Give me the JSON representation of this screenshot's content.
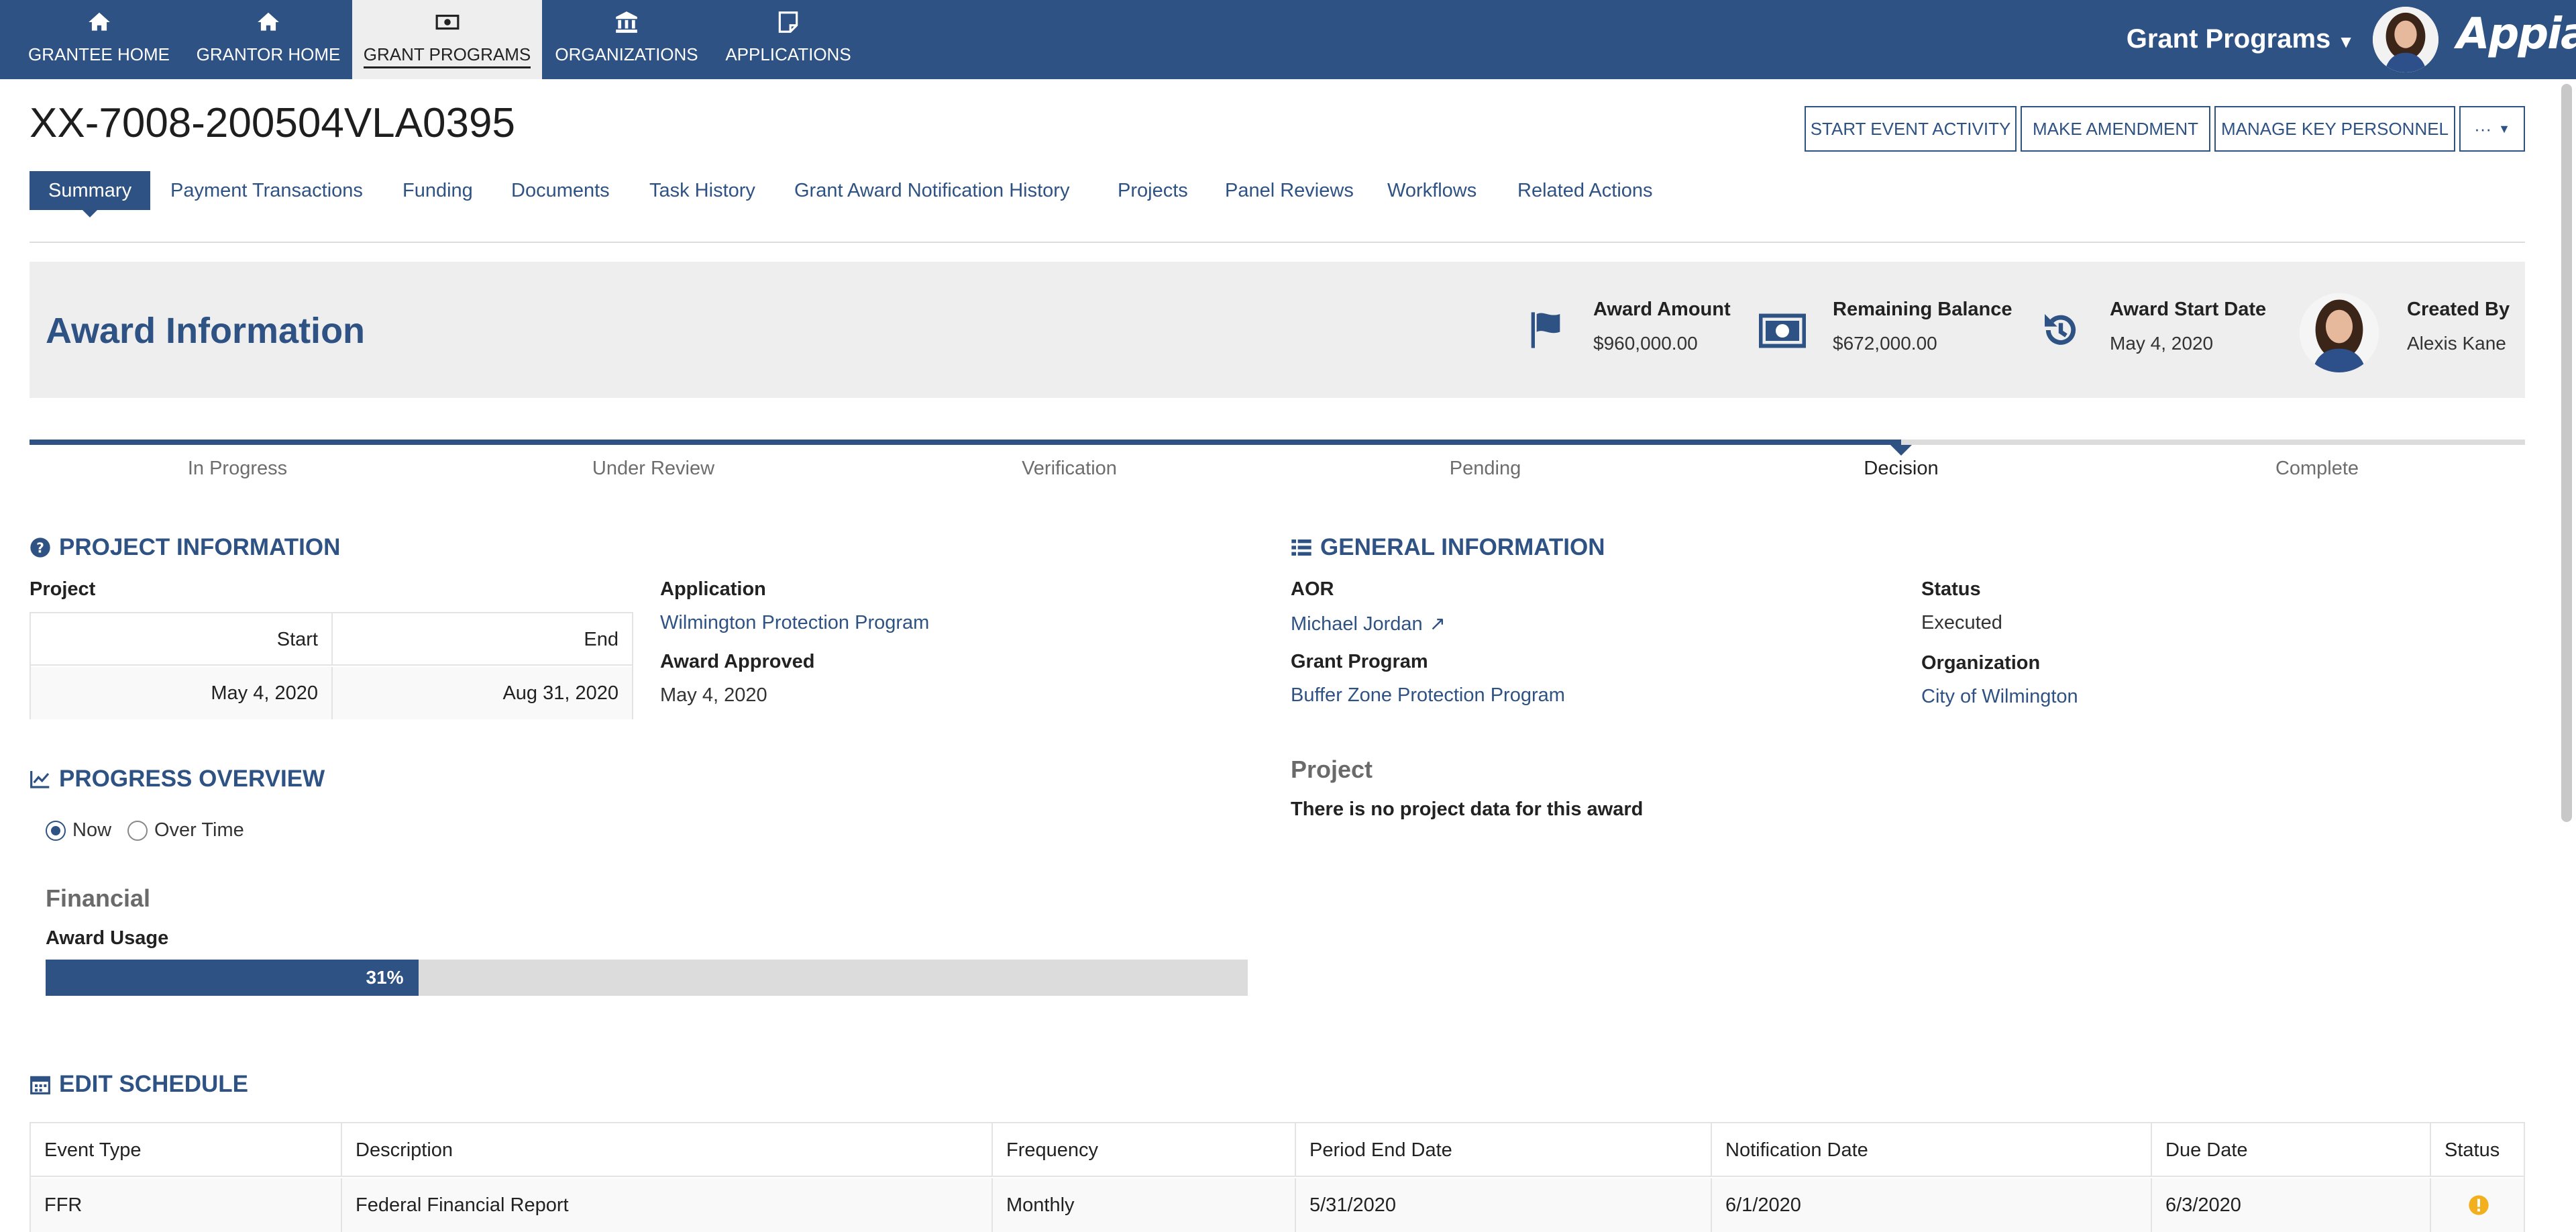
{
  "nav": {
    "tabs": [
      {
        "label": "GRANTEE HOME",
        "icon": "home-icon"
      },
      {
        "label": "GRANTOR HOME",
        "icon": "home-icon"
      },
      {
        "label": "GRANT PROGRAMS",
        "icon": "money-icon"
      },
      {
        "label": "ORGANIZATIONS",
        "icon": "institution-icon"
      },
      {
        "label": "APPLICATIONS",
        "icon": "note-icon"
      }
    ],
    "active_tab": "GRANT PROGRAMS",
    "site_title": "Grant Programs",
    "logo": "Appian"
  },
  "record": {
    "title": "XX-7008-200504VLA0395",
    "actions": [
      "START EVENT ACTIVITY",
      "MAKE AMENDMENT",
      "MANAGE KEY PERSONNEL",
      "···"
    ],
    "tabs": [
      "Summary",
      "Payment Transactions",
      "Funding",
      "Documents",
      "Task History",
      "Grant Award Notification History",
      "Projects",
      "Panel Reviews",
      "Workflows",
      "Related Actions"
    ],
    "active_tab": "Summary"
  },
  "award": {
    "title": "Award Information",
    "kpis": [
      {
        "label": "Award Amount",
        "value": "$960,000.00",
        "icon": "flag-icon"
      },
      {
        "label": "Remaining Balance",
        "value": "$672,000.00",
        "icon": "money-icon"
      },
      {
        "label": "Award Start Date",
        "value": "May 4, 2020",
        "icon": "history-icon"
      },
      {
        "label": "Created By",
        "value": "Alexis Kane",
        "icon": "avatar"
      }
    ]
  },
  "milestone": {
    "steps": [
      "In Progress",
      "Under Review",
      "Verification",
      "Pending",
      "Decision",
      "Complete"
    ],
    "current_index": 4
  },
  "project_info": {
    "heading": "PROJECT INFORMATION",
    "project_label": "Project",
    "start_header": "Start",
    "end_header": "End",
    "start_value": "May 4, 2020",
    "end_value": "Aug 31, 2020",
    "application_label": "Application",
    "application_value": "Wilmington Protection Program",
    "award_approved_label": "Award Approved",
    "award_approved_value": "May 4, 2020"
  },
  "general_info": {
    "heading": "GENERAL INFORMATION",
    "aor_label": "AOR",
    "aor_value": "Michael Jordan",
    "status_label": "Status",
    "status_value": "Executed",
    "grant_program_label": "Grant Program",
    "grant_program_value": "Buffer Zone Protection Program",
    "organization_label": "Organization",
    "organization_value": "City of Wilmington",
    "project_heading": "Project",
    "project_empty": "There is no project data for this award"
  },
  "progress": {
    "heading": "PROGRESS OVERVIEW",
    "options": [
      "Now",
      "Over Time"
    ],
    "selected": "Now",
    "financial_heading": "Financial",
    "usage_label": "Award Usage",
    "usage_percent": 31,
    "usage_text": "31%"
  },
  "schedule": {
    "heading": "EDIT SCHEDULE",
    "columns": [
      "Event Type",
      "Description",
      "Frequency",
      "Period End Date",
      "Notification Date",
      "Due Date",
      "Status"
    ],
    "rows": [
      [
        "FFR",
        "Federal Financial Report",
        "Monthly",
        "5/31/2020",
        "6/1/2020",
        "6/3/2020",
        "warning-icon"
      ]
    ]
  },
  "colors": {
    "brand": "#2e5283",
    "warning": "#f2b01e",
    "banner_bg": "#eeeeee"
  }
}
